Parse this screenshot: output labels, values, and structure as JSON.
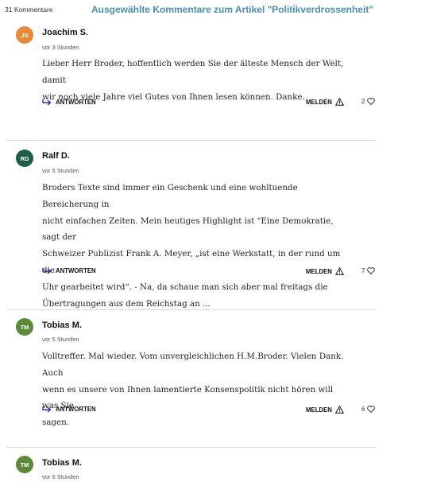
{
  "header": {
    "comment_count": "31 Kommentare",
    "title": "Ausgewählte Kommentare zum Artikel \"Politikverdrossenheit\""
  },
  "comments": [
    {
      "initials": "JS",
      "avatar_color": "#e8883a",
      "author": "Joachim S.",
      "time": "vor 3 Stunden",
      "lines": [
        "Lieber Herr Broder, hoffentlich werden Sie der älteste Mensch der Welt, damit",
        "wir noch viele Jahre viel Gutes von Ihnen lesen können. Danke."
      ],
      "reply_label": "ANTWORTEN",
      "report_label": "MELDEN",
      "likes": "2"
    },
    {
      "initials": "RD",
      "avatar_color": "#1f5e46",
      "author": "Ralf D.",
      "time": "vor 5 Stunden",
      "lines": [
        "Broders Texte sind immer ein Geschenk und eine wohltuende Bereicherung in",
        "nicht einfachen Zeiten. Mein heutiges Highlight ist \"Eine Demokratie, sagt der",
        "Schweizer Publizist Frank A. Meyer, „ist eine Werkstatt, in der rund um die",
        "Uhr gearbeitet wird“. - Na, da schaue man sich aber mal freitags die",
        "Übertragungen aus dem Reichstag an ..."
      ],
      "reply_label": "ANTWORTEN",
      "report_label": "MELDEN",
      "likes": "7"
    },
    {
      "initials": "TM",
      "avatar_color": "#5c8a3a",
      "author": "Tobias M.",
      "time": "vor 5 Stunden",
      "lines": [
        "Volltreffer. Mal wieder. Vom unvergleichlichen H.M.Broder. Vielen Dank. Auch",
        "wenn es unsere von Ihnen lamentierte Konsenspolitik nicht hören will was Sie",
        "sagen."
      ],
      "reply_label": "ANTWORTEN",
      "report_label": "MELDEN",
      "likes": "6"
    },
    {
      "initials": "TM",
      "avatar_color": "#5c8a3a",
      "author": "Tobias M.",
      "time": "vor 6 Stunden"
    }
  ]
}
